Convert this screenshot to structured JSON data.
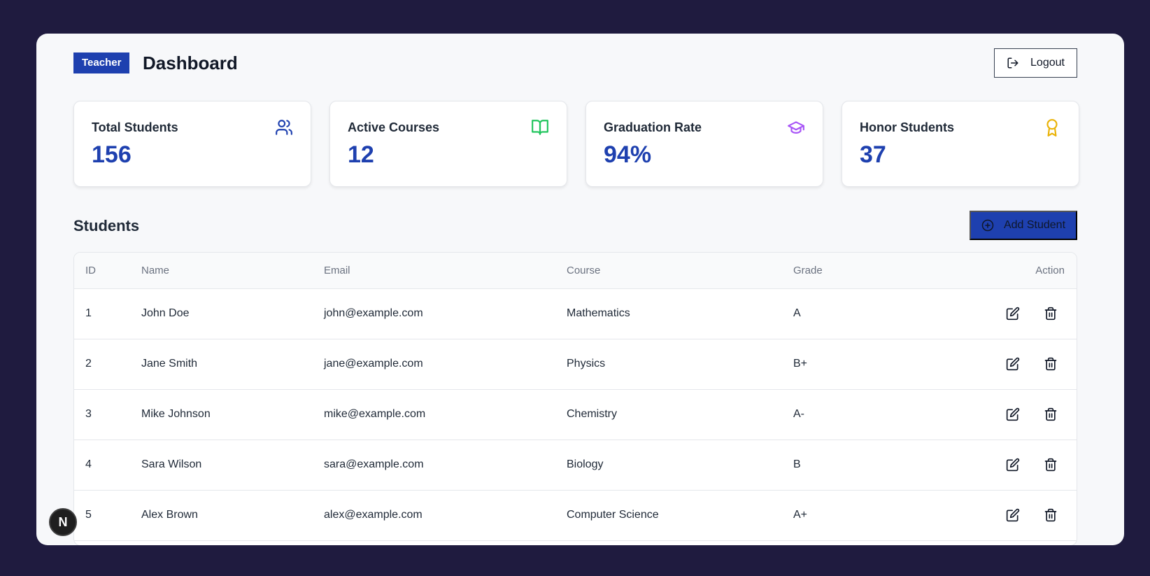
{
  "header": {
    "role_badge": "Teacher",
    "title": "Dashboard",
    "logout_label": "Logout"
  },
  "stats": [
    {
      "label": "Total Students",
      "value": "156",
      "icon": "users-icon",
      "icon_color": "#1e40af"
    },
    {
      "label": "Active Courses",
      "value": "12",
      "icon": "book-open-icon",
      "icon_color": "#22c55e"
    },
    {
      "label": "Graduation Rate",
      "value": "94%",
      "icon": "graduation-cap-icon",
      "icon_color": "#a855f7"
    },
    {
      "label": "Honor Students",
      "value": "37",
      "icon": "award-icon",
      "icon_color": "#eab308"
    }
  ],
  "students": {
    "title": "Students",
    "add_label": "Add Student",
    "columns": [
      "ID",
      "Name",
      "Email",
      "Course",
      "Grade",
      "Action"
    ],
    "rows": [
      {
        "id": "1",
        "name": "John Doe",
        "email": "john@example.com",
        "course": "Mathematics",
        "grade": "A"
      },
      {
        "id": "2",
        "name": "Jane Smith",
        "email": "jane@example.com",
        "course": "Physics",
        "grade": "B+"
      },
      {
        "id": "3",
        "name": "Mike Johnson",
        "email": "mike@example.com",
        "course": "Chemistry",
        "grade": "A-"
      },
      {
        "id": "4",
        "name": "Sara Wilson",
        "email": "sara@example.com",
        "course": "Biology",
        "grade": "B"
      },
      {
        "id": "5",
        "name": "Alex Brown",
        "email": "alex@example.com",
        "course": "Computer Science",
        "grade": "A+"
      }
    ]
  },
  "dev_indicator": {
    "label": "N"
  },
  "colors": {
    "primary": "#1e40af",
    "background": "#1f1b3f",
    "surface": "#f7f8fa"
  }
}
